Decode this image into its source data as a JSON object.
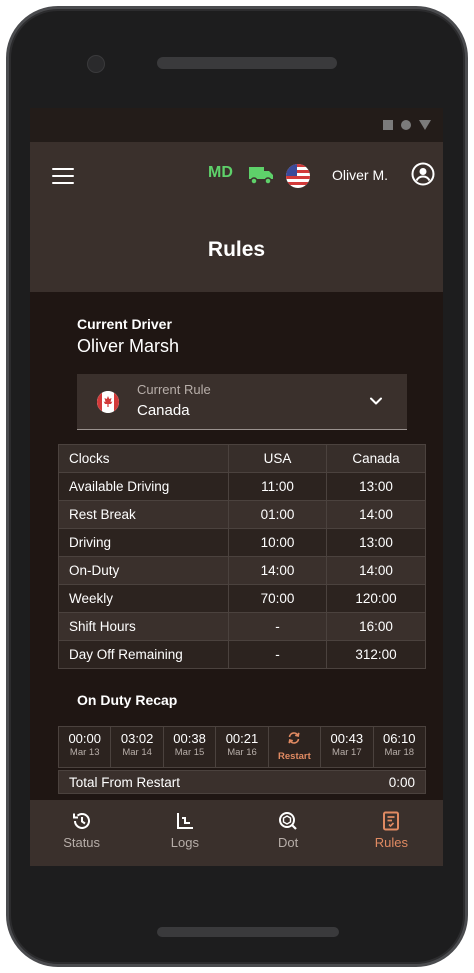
{
  "app": {
    "status_icons": [
      "square-icon",
      "circle-icon",
      "triangle-icon"
    ],
    "header": {
      "md_badge": "MD",
      "user_name": "Oliver M.",
      "page_title": "Rules"
    }
  },
  "driver": {
    "label": "Current Driver",
    "name": "Oliver Marsh"
  },
  "rule_select": {
    "label": "Current Rule",
    "value": "Canada"
  },
  "clocks": {
    "headers": [
      "Clocks",
      "USA",
      "Canada"
    ],
    "rows": [
      [
        "Available Driving",
        "11:00",
        "13:00"
      ],
      [
        "Rest Break",
        "01:00",
        "14:00"
      ],
      [
        "Driving",
        "10:00",
        "13:00"
      ],
      [
        "On-Duty",
        "14:00",
        "14:00"
      ],
      [
        "Weekly",
        "70:00",
        "120:00"
      ],
      [
        "Shift Hours",
        "-",
        "16:00"
      ],
      [
        "Day Off Remaining",
        "-",
        "312:00"
      ]
    ]
  },
  "recap": {
    "title": "On Duty Recap",
    "days": [
      {
        "time": "00:00",
        "date": "Mar 13"
      },
      {
        "time": "03:02",
        "date": "Mar 14"
      },
      {
        "time": "00:38",
        "date": "Mar 15"
      },
      {
        "time": "00:21",
        "date": "Mar 16"
      },
      {
        "time": "",
        "date": "Restart"
      },
      {
        "time": "00:43",
        "date": "Mar 17"
      },
      {
        "time": "06:10",
        "date": "Mar 18"
      }
    ],
    "total_label": "Total From Restart",
    "total_value": "0:00"
  },
  "nav": {
    "items": [
      {
        "label": "Status",
        "icon": "history-icon"
      },
      {
        "label": "Logs",
        "icon": "chart-icon"
      },
      {
        "label": "Dot",
        "icon": "inspection-icon"
      },
      {
        "label": "Rules",
        "icon": "rules-icon"
      }
    ],
    "active": "Rules"
  },
  "colors": {
    "accent": "#e08a62",
    "md_green": "#5ed16a",
    "header_bg": "#3a302c",
    "content_bg": "#1f1613"
  }
}
